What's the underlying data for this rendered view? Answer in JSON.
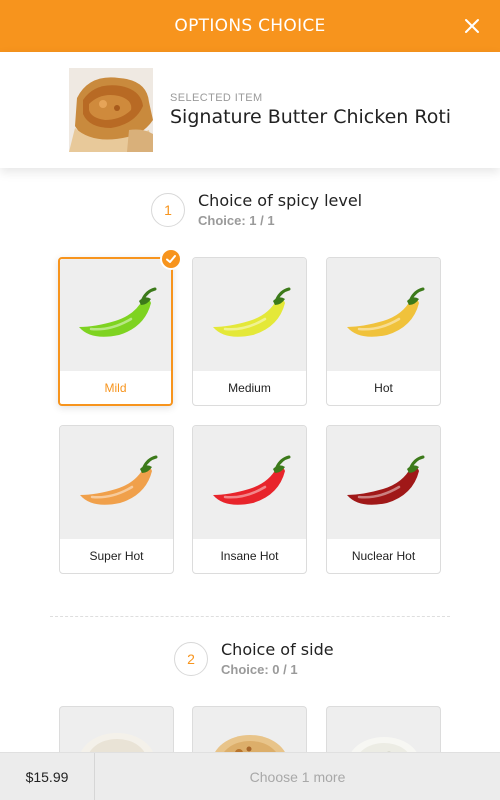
{
  "header": {
    "title": "OPTIONS CHOICE",
    "close_icon": "close-icon",
    "color": "#f7941d"
  },
  "selected_item": {
    "caption": "SELECTED ITEM",
    "name": "Signature Butter Chicken Roti"
  },
  "sections": [
    {
      "number": "1",
      "title": "Choice of spicy level",
      "choice": "Choice: 1 / 1",
      "options": [
        {
          "label": "Mild",
          "selected": true,
          "pepper_color": "#7ed321"
        },
        {
          "label": "Medium",
          "selected": false,
          "pepper_color": "#e4e838"
        },
        {
          "label": "Hot",
          "selected": false,
          "pepper_color": "#f0c23b"
        },
        {
          "label": "Super Hot",
          "selected": false,
          "pepper_color": "#f0a04b"
        },
        {
          "label": "Insane Hot",
          "selected": false,
          "pepper_color": "#e8242b"
        },
        {
          "label": "Nuclear Hot",
          "selected": false,
          "pepper_color": "#a01818"
        }
      ]
    },
    {
      "number": "2",
      "title": "Choice of side",
      "choice": "Choice: 0 / 1"
    }
  ],
  "footer": {
    "price": "$15.99",
    "action": "Choose 1 more"
  }
}
